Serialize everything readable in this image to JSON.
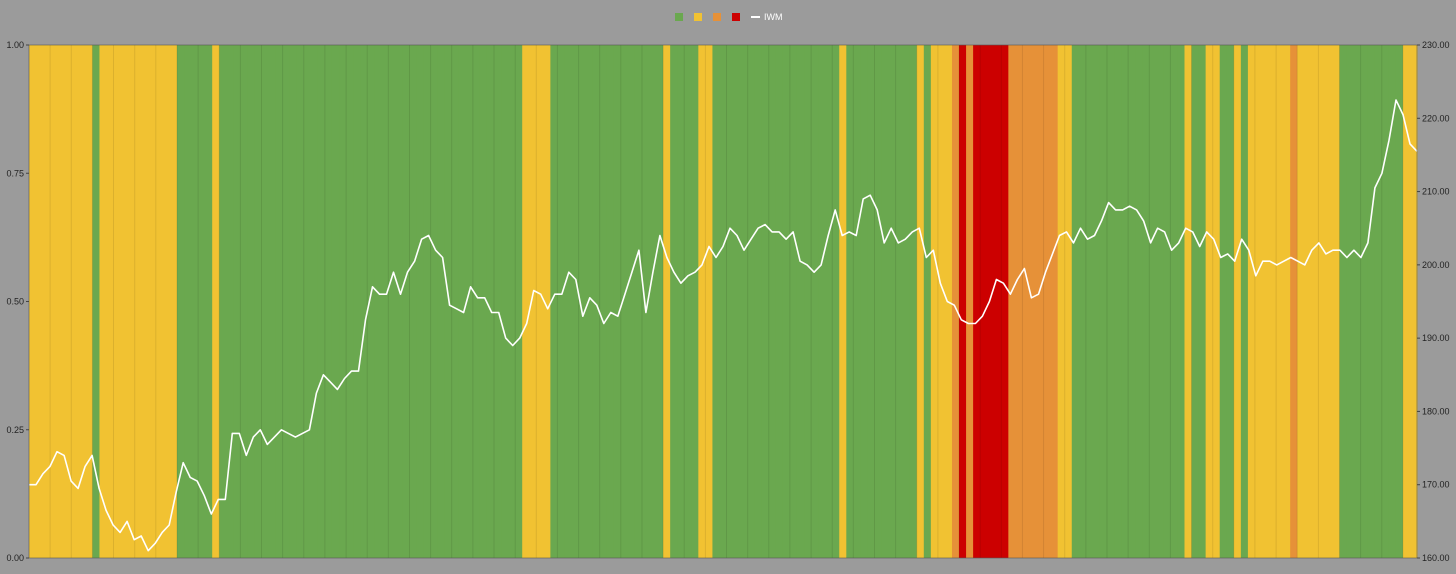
{
  "chart_data": {
    "type": "area",
    "title": "",
    "xlabel": "",
    "y_left": {
      "ylim": [
        0,
        1
      ],
      "ticks": [
        "0.00",
        "0.25",
        "0.50",
        "0.75",
        "1.00"
      ]
    },
    "y_right": {
      "ylim": [
        160,
        230
      ],
      "ticks": [
        "160.00",
        "170.00",
        "180.00",
        "190.00",
        "200.00",
        "210.00",
        "220.00",
        "230.00"
      ]
    },
    "grid": false,
    "legend": {
      "placement": "top-center",
      "entries": [
        {
          "name": "",
          "color": "#6aa84f",
          "marker": "square"
        },
        {
          "name": "",
          "color": "#f1c232",
          "marker": "square"
        },
        {
          "name": "",
          "color": "#e69138",
          "marker": "square"
        },
        {
          "name": "",
          "color": "#cc0000",
          "marker": "square"
        },
        {
          "name": "IWM",
          "color": "#ffffff",
          "marker": "line"
        }
      ]
    },
    "regime_colors": {
      "G": "#6aa84f",
      "Y": "#f1c232",
      "O": "#e69138",
      "R": "#cc0000"
    },
    "regimes": [
      "Y",
      "Y",
      "Y",
      "Y",
      "Y",
      "Y",
      "Y",
      "Y",
      "Y",
      "G",
      "Y",
      "Y",
      "Y",
      "Y",
      "Y",
      "Y",
      "Y",
      "Y",
      "Y",
      "Y",
      "Y",
      "G",
      "G",
      "G",
      "G",
      "G",
      "Y",
      "G",
      "G",
      "G",
      "G",
      "G",
      "G",
      "G",
      "G",
      "G",
      "G",
      "G",
      "G",
      "G",
      "G",
      "G",
      "G",
      "G",
      "G",
      "G",
      "G",
      "G",
      "G",
      "G",
      "G",
      "G",
      "G",
      "G",
      "G",
      "G",
      "G",
      "G",
      "G",
      "G",
      "G",
      "G",
      "G",
      "G",
      "G",
      "G",
      "G",
      "G",
      "G",
      "G",
      "Y",
      "Y",
      "Y",
      "Y",
      "G",
      "G",
      "G",
      "G",
      "G",
      "G",
      "G",
      "G",
      "G",
      "G",
      "G",
      "G",
      "G",
      "G",
      "G",
      "G",
      "Y",
      "G",
      "G",
      "G",
      "G",
      "Y",
      "Y",
      "G",
      "G",
      "G",
      "G",
      "G",
      "G",
      "G",
      "G",
      "G",
      "G",
      "G",
      "G",
      "G",
      "G",
      "G",
      "G",
      "G",
      "G",
      "Y",
      "G",
      "G",
      "G",
      "G",
      "G",
      "G",
      "G",
      "G",
      "G",
      "G",
      "Y",
      "G",
      "Y",
      "Y",
      "Y",
      "O",
      "R",
      "O",
      "R",
      "R",
      "R",
      "R",
      "R",
      "O",
      "O",
      "O",
      "O",
      "O",
      "O",
      "O",
      "Y",
      "Y",
      "G",
      "G",
      "G",
      "G",
      "G",
      "G",
      "G",
      "G",
      "G",
      "G",
      "G",
      "G",
      "G",
      "G",
      "G",
      "G",
      "Y",
      "G",
      "G",
      "Y",
      "Y",
      "G",
      "G",
      "Y",
      "G",
      "Y",
      "Y",
      "Y",
      "Y",
      "Y",
      "Y",
      "O",
      "Y",
      "Y",
      "Y",
      "Y",
      "Y",
      "Y",
      "G",
      "G",
      "G",
      "G",
      "G",
      "G",
      "G",
      "G",
      "G",
      "Y",
      "Y"
    ],
    "series": [
      {
        "name": "IWM",
        "color": "#ffffff",
        "values": [
          170.0,
          170.0,
          171.5,
          172.5,
          174.5,
          174.0,
          170.5,
          169.5,
          172.5,
          174.0,
          169.5,
          166.5,
          164.5,
          163.5,
          165.0,
          162.5,
          163.0,
          161.0,
          162.0,
          163.5,
          164.5,
          169.0,
          173.0,
          171.0,
          170.5,
          168.5,
          166.0,
          168.0,
          168.0,
          177.0,
          177.0,
          174.0,
          176.5,
          177.5,
          175.5,
          176.5,
          177.5,
          177.0,
          176.5,
          177.0,
          177.5,
          182.5,
          185.0,
          184.0,
          183.0,
          184.5,
          185.5,
          185.5,
          192.5,
          197.0,
          196.0,
          196.0,
          199.0,
          196.0,
          199.0,
          200.5,
          203.5,
          204.0,
          202.0,
          201.0,
          194.5,
          194.0,
          193.5,
          197.0,
          195.5,
          195.5,
          193.5,
          193.5,
          190.0,
          189.0,
          190.0,
          192.0,
          196.5,
          196.0,
          194.0,
          196.0,
          196.0,
          199.0,
          198.0,
          193.0,
          195.5,
          194.5,
          192.0,
          193.5,
          193.0,
          196.0,
          199.0,
          202.0,
          193.5,
          199.0,
          204.0,
          201.0,
          199.0,
          197.5,
          198.5,
          199.0,
          200.0,
          202.5,
          201.0,
          202.5,
          205.0,
          204.0,
          202.0,
          203.5,
          205.0,
          205.5,
          204.5,
          204.5,
          203.5,
          204.5,
          200.5,
          200.0,
          199.0,
          200.0,
          204.0,
          207.5,
          204.0,
          204.5,
          204.0,
          209.0,
          209.5,
          207.5,
          203.0,
          205.0,
          203.0,
          203.5,
          204.5,
          205.0,
          201.0,
          202.0,
          197.5,
          195.0,
          194.5,
          192.5,
          192.0,
          192.0,
          193.0,
          195.0,
          198.0,
          197.5,
          196.0,
          198.0,
          199.5,
          195.5,
          196.0,
          199.0,
          201.5,
          204.0,
          204.5,
          203.0,
          205.0,
          203.5,
          204.0,
          206.0,
          208.5,
          207.5,
          207.5,
          208.0,
          207.5,
          206.0,
          203.0,
          205.0,
          204.5,
          202.0,
          203.0,
          205.0,
          204.5,
          202.5,
          204.5,
          203.5,
          201.0,
          201.5,
          200.5,
          203.5,
          202.0,
          198.5,
          200.5,
          200.5,
          200.0,
          200.5,
          201.0,
          200.5,
          200.0,
          202.0,
          203.0,
          201.5,
          202.0,
          202.0,
          201.0,
          202.0,
          201.0,
          203.0,
          210.5,
          212.5,
          217.0,
          222.5,
          220.5,
          216.5,
          215.5
        ]
      }
    ]
  }
}
